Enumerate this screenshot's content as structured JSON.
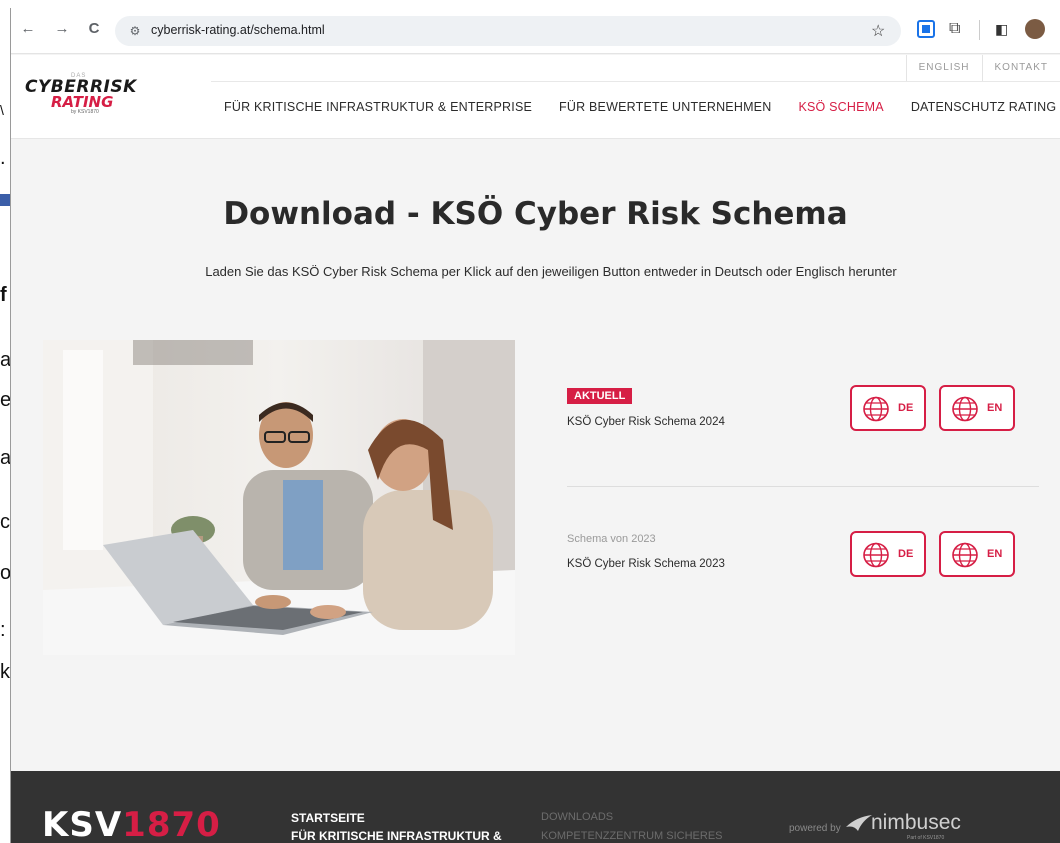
{
  "background": {
    "chars": [
      "\\",
      ".",
      "f",
      "a",
      "e",
      "a",
      "c",
      "o",
      ":",
      "k"
    ]
  },
  "browser": {
    "url": "cyberrisk-rating.at/schema.html",
    "back": "←",
    "forward": "→",
    "reload": "C"
  },
  "header": {
    "logo_top": "DAS",
    "logo_line1": "CYBERRISK",
    "logo_line2": "RATING",
    "logo_by": "by KSV1870",
    "top_links": [
      "ENGLISH",
      "KONTAKT"
    ],
    "nav": [
      "FÜR KRITISCHE INFRASTRUKTUR & ENTERPRISE",
      "FÜR BEWERTETE UNTERNEHMEN",
      "KSÖ SCHEMA",
      "DATENSCHUTZ RATING"
    ]
  },
  "main": {
    "title": "Download - KSÖ Cyber Risk Schema",
    "subtitle": "Laden Sie das KSÖ Cyber Risk Schema per Klick auf den jeweiligen Button entweder in Deutsch oder Englisch herunter",
    "rows": [
      {
        "badge": "AKTUELL",
        "caption": "",
        "title": "KSÖ Cyber Risk Schema 2024",
        "btn_de": "DE",
        "btn_en": "EN"
      },
      {
        "badge": "",
        "caption": "Schema von 2023",
        "title": "KSÖ Cyber Risk Schema 2023",
        "btn_de": "DE",
        "btn_en": "EN"
      }
    ]
  },
  "footer": {
    "logo_white": "KSV",
    "logo_red": "1870",
    "links": [
      "STARTSEITE",
      "FÜR KRITISCHE INFRASTRUKTUR &",
      "DOWNLOADS",
      "KOMPETENZZENTRUM SICHERES"
    ],
    "powered_by": "powered by",
    "nimbus": "nimbusec",
    "nimbus_part": "Part of KSV1870"
  },
  "colors": {
    "accent": "#d61e45",
    "footer_bg": "#333333",
    "page_bg": "#f4f4f4"
  }
}
